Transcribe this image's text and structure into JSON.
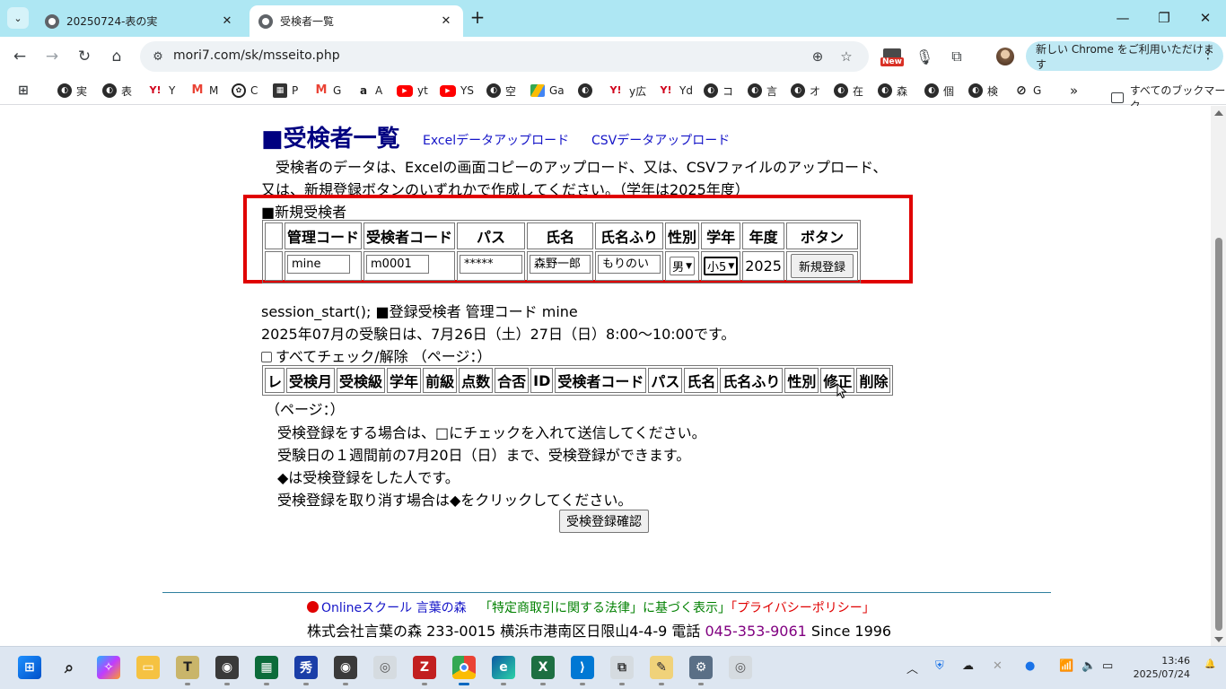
{
  "browser": {
    "tabs": [
      {
        "title": "20250724-表の実"
      },
      {
        "title": "受検者一覧"
      }
    ],
    "url": "mori7.com/sk/msseito.php",
    "new_badge": "New",
    "update_label": "新しい Chrome をご利用いただけます",
    "bookmarks": [
      {
        "label": "実",
        "icon": "globe-icon"
      },
      {
        "label": "表",
        "icon": "globe-icon"
      },
      {
        "label": "Y",
        "icon": "yahoo-icon"
      },
      {
        "label": "M",
        "icon": "gmail-icon"
      },
      {
        "label": "C",
        "icon": "openai-icon"
      },
      {
        "label": "P",
        "icon": "app-icon"
      },
      {
        "label": "G",
        "icon": "gmail-icon"
      },
      {
        "label": "A",
        "icon": "amazon-icon"
      },
      {
        "label": "yt",
        "icon": "youtube-icon"
      },
      {
        "label": "YS",
        "icon": "youtube-icon"
      },
      {
        "label": "空",
        "icon": "globe-icon"
      },
      {
        "label": "Ga",
        "icon": "drive-icon"
      },
      {
        "label": "",
        "icon": "globe-icon"
      },
      {
        "label": "y広",
        "icon": "yahoo-icon"
      },
      {
        "label": "Yd",
        "icon": "yahoo-icon"
      },
      {
        "label": "コ",
        "icon": "globe-icon"
      },
      {
        "label": "言",
        "icon": "globe-icon"
      },
      {
        "label": "オ",
        "icon": "globe-icon"
      },
      {
        "label": "在",
        "icon": "globe-icon"
      },
      {
        "label": "森",
        "icon": "globe-icon"
      },
      {
        "label": "個",
        "icon": "globe-icon"
      },
      {
        "label": "検",
        "icon": "globe-icon"
      },
      {
        "label": "G",
        "icon": "leaf-icon"
      }
    ],
    "all_bookmarks": "すべてのブックマーク"
  },
  "page": {
    "title": "■受検者一覧",
    "link_excel": "Excelデータアップロード",
    "link_csv": "CSVデータアップロード",
    "intro_line1": "　受検者のデータは、Excelの画面コピーのアップロード、又は、CSVファイルのアップロード、",
    "intro_line2": "又は、新規登録ボタンのいずれかで作成してください。（学年は2025年度）",
    "new_section": {
      "title": "■新規受検者",
      "headers": [
        "",
        "管理コード",
        "受検者コード",
        "パス",
        "氏名",
        "氏名ふり",
        "性別",
        "学年",
        "年度",
        "ボタン"
      ],
      "admin_code": "mine",
      "examinee_code": "m0001",
      "password": "*****",
      "name": "森野一郎",
      "name_kana": "もりのい",
      "gender": "男",
      "grade": "小5",
      "year": "2025",
      "register_button": "新規登録"
    },
    "session_line": "session_start(); ■登録受検者 管理コード mine",
    "exam_date_line": "2025年07月の受験日は、7月26日（土）27日（日）8:00〜10:00です。",
    "check_all": "すべてチェック/解除 （ページ：）",
    "list_headers": [
      "レ",
      "受検月",
      "受検級",
      "学年",
      "前級",
      "点数",
      "合否",
      "ID",
      "受検者コード",
      "パス",
      "氏名",
      "氏名ふり",
      "性別",
      "修正",
      "削除"
    ],
    "page_label": "（ページ：）",
    "notes": [
      "受検登録をする場合は、□にチェックを入れて送信してください。",
      "受験日の１週間前の7月20日（日）まで、受検登録ができます。",
      "◆は受検登録をした人です。",
      "受検登録を取り消す場合は◆をクリックしてください。"
    ],
    "confirm_button": "受検登録確認"
  },
  "footer": {
    "link_online": "Onlineスクール 言葉の森",
    "link_law": "「特定商取引に関する法律」に基づく表示」",
    "link_privacy": "「プライバシーポリシー」",
    "company": "株式会社言葉の森 233-0015 横浜市港南区日限山4-4-9 電話",
    "phone": "045-353-9061",
    "since": "Since 1996"
  },
  "taskbar": {
    "time": "13:46",
    "date": "2025/07/24"
  },
  "colors": {
    "tabstrip": "#aee7f3",
    "heading": "#000080",
    "link": "#1515c8",
    "highlight_box": "#e00000",
    "footer_law": "#008000",
    "footer_privacy": "#e00000",
    "phone": "#800080"
  }
}
